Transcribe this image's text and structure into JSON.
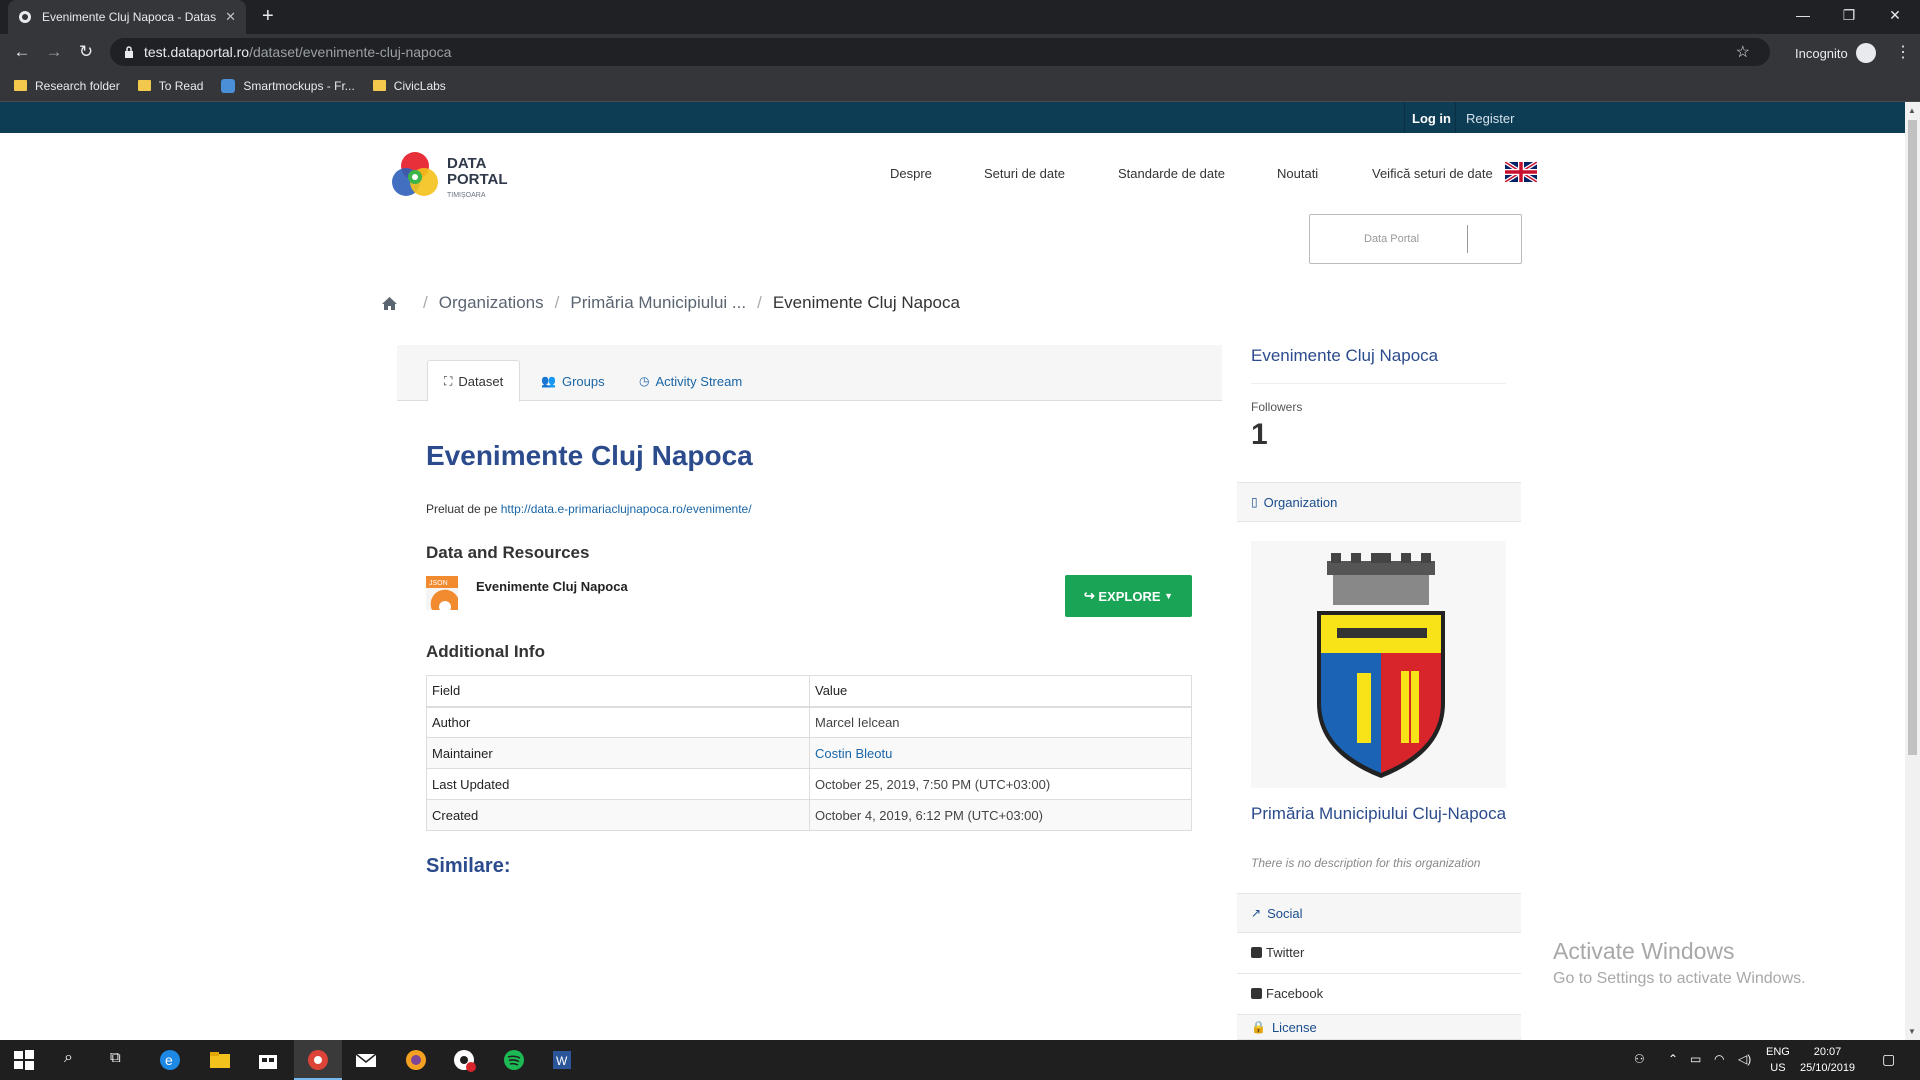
{
  "browser": {
    "tab_title": "Evenimente Cluj Napoca - Datas",
    "new_tab": "+",
    "url_host": "test.dataportal.ro",
    "url_path": "/dataset/evenimente-cluj-napoca",
    "incognito_label": "Incognito",
    "bookmarks": [
      "Research folder",
      "To Read",
      "Smartmockups - Fr...",
      "CivicLabs"
    ]
  },
  "site": {
    "top_links": {
      "login": "Log in",
      "register": "Register"
    },
    "logo": {
      "line1": "DATA",
      "line2": "PORTAL",
      "sub": "TIMIȘOARA"
    },
    "nav": [
      "Despre",
      "Seturi de date",
      "Standarde de date",
      "Noutati",
      "Veifică seturi de date"
    ],
    "search_placeholder": "Data Portal",
    "breadcrumb": [
      "Organizations",
      "Primăria Municipiului ...",
      "Evenimente Cluj Napoca"
    ]
  },
  "main": {
    "tabs": [
      "Dataset",
      "Groups",
      "Activity Stream"
    ],
    "title": "Evenimente Cluj Napoca",
    "source_prefix": "Preluat de pe",
    "source_url": "http://data.e-primariaclujnapoca.ro/evenimente/",
    "resources_heading": "Data and Resources",
    "resource_name": "Evenimente Cluj Napoca",
    "resource_format": "JSON",
    "explore_label": "EXPLORE",
    "additional_heading": "Additional Info",
    "table_headers": [
      "Field",
      "Value"
    ],
    "table_rows": [
      [
        "Author",
        "Marcel Ielcean"
      ],
      [
        "Maintainer",
        "Costin Bleotu"
      ],
      [
        "Last Updated",
        "October 25, 2019, 7:50 PM (UTC+03:00)"
      ],
      [
        "Created",
        "October 4, 2019, 6:12 PM (UTC+03:00)"
      ]
    ],
    "similar_heading": "Similare:"
  },
  "sidebar": {
    "title": "Evenimente Cluj Napoca",
    "followers_label": "Followers",
    "followers_count": "1",
    "organization_label": "Organization",
    "org_name": "Primăria Municipiului Cluj-Napoca",
    "org_desc": "There is no description for this organization",
    "social_label": "Social",
    "twitter": "Twitter",
    "facebook": "Facebook",
    "license_label": "License"
  },
  "watermark": {
    "line1": "Activate Windows",
    "line2": "Go to Settings to activate Windows."
  },
  "taskbar": {
    "lang_top": "ENG",
    "lang_bottom": "US",
    "time": "20:07",
    "date": "25/10/2019"
  },
  "colors": {
    "site_topbar": "#0d3c55",
    "link": "#1a66a6",
    "heading": "#2b4b8c",
    "explore": "#1aa556"
  }
}
